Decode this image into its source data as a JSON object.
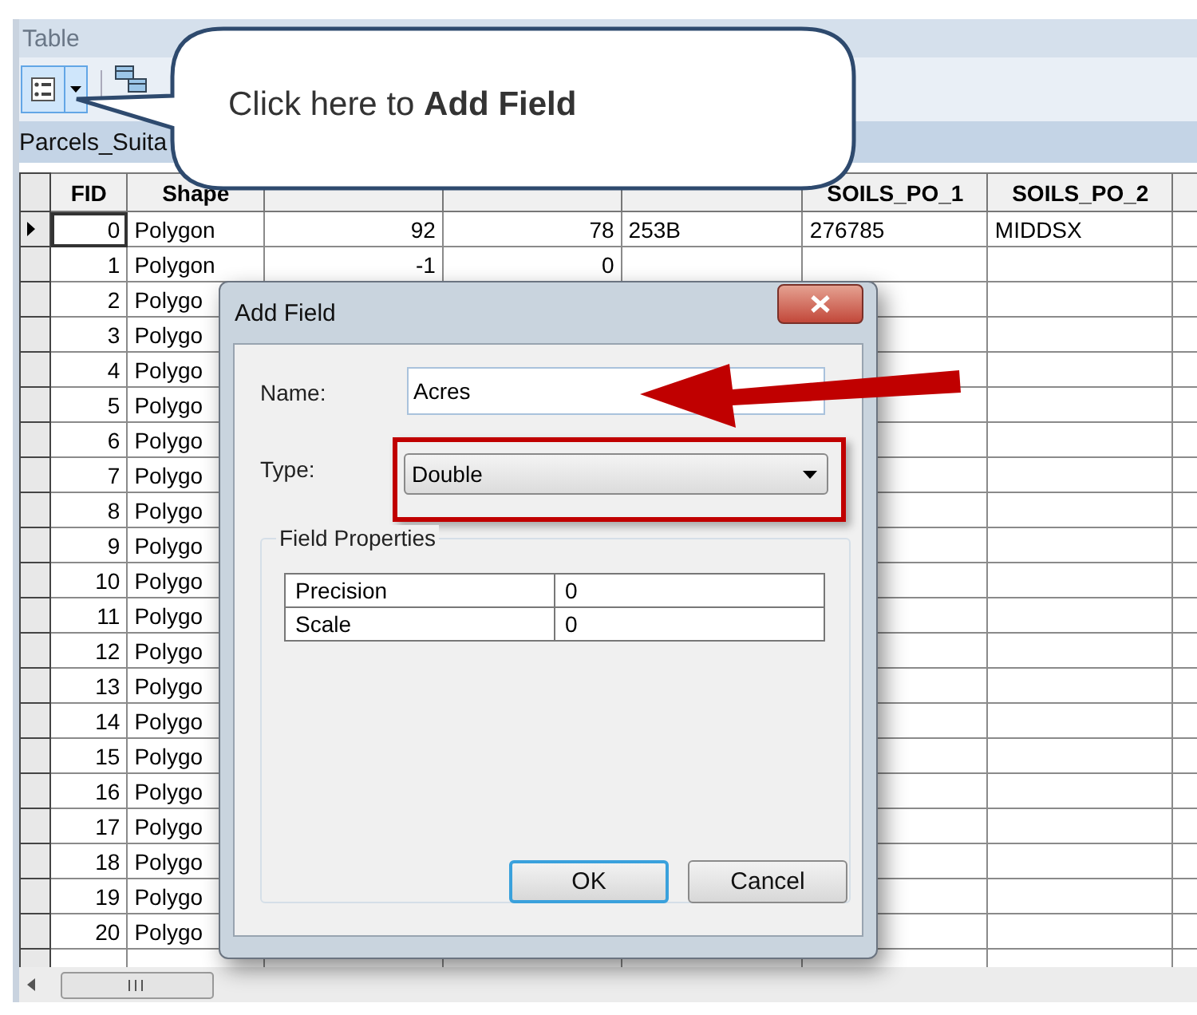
{
  "window": {
    "title": "Table"
  },
  "layer_tab": "Parcels_Suita",
  "table": {
    "columns": [
      "FID",
      "Shape",
      null,
      null,
      null,
      "SOILS_PO_1",
      "SOILS_PO_2"
    ],
    "rows": [
      {
        "selected": true,
        "cells": [
          "0",
          "Polygon",
          "92",
          "78",
          "253B",
          "276785",
          "MIDDSX"
        ]
      },
      {
        "selected": false,
        "cells": [
          "1",
          "Polygon",
          "-1",
          "0",
          null,
          null,
          null
        ]
      },
      {
        "selected": false,
        "cells": [
          "2",
          "Polygo"
        ]
      },
      {
        "selected": false,
        "cells": [
          "3",
          "Polygo"
        ]
      },
      {
        "selected": false,
        "cells": [
          "4",
          "Polygo"
        ]
      },
      {
        "selected": false,
        "cells": [
          "5",
          "Polygo"
        ]
      },
      {
        "selected": false,
        "cells": [
          "6",
          "Polygo"
        ]
      },
      {
        "selected": false,
        "cells": [
          "7",
          "Polygo"
        ]
      },
      {
        "selected": false,
        "cells": [
          "8",
          "Polygo"
        ]
      },
      {
        "selected": false,
        "cells": [
          "9",
          "Polygo"
        ]
      },
      {
        "selected": false,
        "cells": [
          "10",
          "Polygo"
        ]
      },
      {
        "selected": false,
        "cells": [
          "11",
          "Polygo"
        ]
      },
      {
        "selected": false,
        "cells": [
          "12",
          "Polygo"
        ]
      },
      {
        "selected": false,
        "cells": [
          "13",
          "Polygo"
        ]
      },
      {
        "selected": false,
        "cells": [
          "14",
          "Polygo"
        ]
      },
      {
        "selected": false,
        "cells": [
          "15",
          "Polygo"
        ]
      },
      {
        "selected": false,
        "cells": [
          "16",
          "Polygo"
        ]
      },
      {
        "selected": false,
        "cells": [
          "17",
          "Polygo"
        ]
      },
      {
        "selected": false,
        "cells": [
          "18",
          "Polygo"
        ]
      },
      {
        "selected": false,
        "cells": [
          "19",
          "Polygo"
        ]
      },
      {
        "selected": false,
        "cells": [
          "20",
          "Polygo"
        ]
      },
      {
        "selected": false,
        "cells": []
      }
    ]
  },
  "callout": {
    "text": "Click here to **Add Field**"
  },
  "dialog": {
    "title": "Add Field",
    "fields": [
      {
        "kind": "text",
        "label": "Name:",
        "value": "Acres"
      },
      {
        "kind": "dropdown",
        "label": "Type:",
        "value": "Double",
        "highlighted": true
      }
    ],
    "group": {
      "title": "Field Properties",
      "rows": [
        {
          "property": "Precision",
          "value": "0"
        },
        {
          "property": "Scale",
          "value": "0"
        }
      ]
    },
    "buttons": [
      {
        "label": "OK",
        "default": true
      },
      {
        "label": "Cancel",
        "default": false
      }
    ]
  }
}
